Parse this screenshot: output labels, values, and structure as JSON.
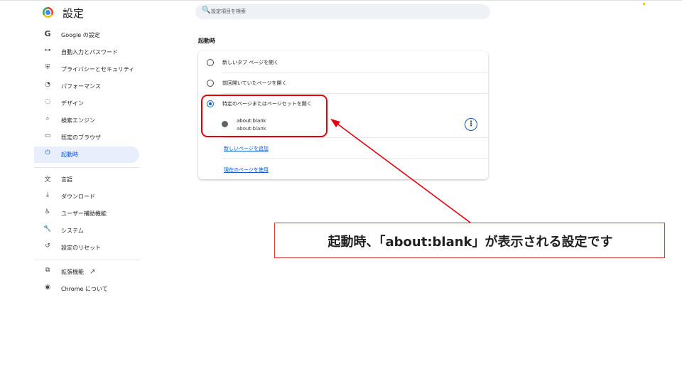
{
  "header": {
    "title": "設定",
    "search_placeholder": "設定項目を検索",
    "search_icon": "🔍"
  },
  "sidebar": {
    "items": [
      {
        "label": "Google の設定",
        "icon": "G"
      },
      {
        "label": "自動入力とパスワード",
        "icon": "⊶"
      },
      {
        "label": "プライバシーとセキュリティ",
        "icon": "⛨"
      },
      {
        "label": "パフォーマンス",
        "icon": "◔"
      },
      {
        "label": "デザイン",
        "icon": "◌"
      },
      {
        "label": "検索エンジン",
        "icon": "⌕"
      },
      {
        "label": "既定のブラウザ",
        "icon": "▭"
      },
      {
        "label": "起動時",
        "icon": "⏻"
      },
      {
        "label": "言語",
        "icon": "文"
      },
      {
        "label": "ダウンロード",
        "icon": "⤓"
      },
      {
        "label": "ユーザー補助機能",
        "icon": "♿"
      },
      {
        "label": "システム",
        "icon": "🔧"
      },
      {
        "label": "設定のリセット",
        "icon": "↺"
      },
      {
        "label": "拡張機能",
        "icon": "⧉",
        "ext_icon": "↗"
      },
      {
        "label": "Chrome について",
        "icon": "◉"
      }
    ],
    "active_index": 7
  },
  "main": {
    "section_title": "起動時",
    "options": [
      {
        "label": "新しいタブ ページを開く",
        "checked": false
      },
      {
        "label": "前回開いていたページを開く",
        "checked": false
      },
      {
        "label": "特定のページまたはページセットを開く",
        "checked": true
      }
    ],
    "page_entry": {
      "title": "about:blank",
      "url": "about:blank",
      "more_icon": "⋮"
    },
    "links": {
      "add_page": "新しいページを追加",
      "use_current": "現在のページを使用"
    }
  },
  "annotation": {
    "callout_text": "起動時、「about:blank」が表示される設定です",
    "color": "#e3000f"
  }
}
